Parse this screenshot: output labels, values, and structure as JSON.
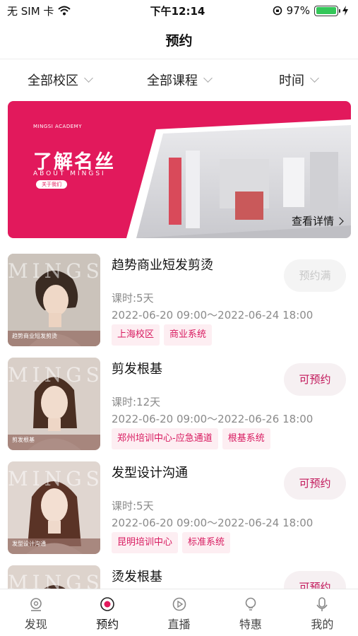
{
  "status_bar": {
    "carrier": "无 SIM 卡",
    "time": "下午12:14",
    "battery": "97%",
    "battery_level": 0.97
  },
  "nav": {
    "title": "预约"
  },
  "filters": [
    {
      "label": "全部校区"
    },
    {
      "label": "全部课程"
    },
    {
      "label": "时间"
    }
  ],
  "banner": {
    "academy": "MINGSI ACADEMY",
    "title": "了解名丝",
    "subtitle": "ABOUT MINGSI",
    "button": "关于我们",
    "detail_link": "查看详情"
  },
  "courses": [
    {
      "title": "趋势商业短发剪烫",
      "hours": "课时:5天",
      "time": "2022-06-20 09:00～2022-06-24 18:00",
      "tags": [
        "上海校区",
        "商业系统"
      ],
      "button": "预约满",
      "status": "full",
      "thumb_text": "MINGSI",
      "thumb_caption": "趋势商业短发剪烫"
    },
    {
      "title": "剪发根基",
      "hours": "课时:12天",
      "time": "2022-06-20 09:00～2022-06-26 18:00",
      "tags": [
        "郑州培训中心-应急通道",
        "根基系统"
      ],
      "button": "可预约",
      "status": "open",
      "thumb_text": "MINGSI",
      "thumb_caption": "剪发根基"
    },
    {
      "title": "发型设计沟通",
      "hours": "课时:5天",
      "time": "2022-06-20 09:00～2022-06-24 18:00",
      "tags": [
        "昆明培训中心",
        "标准系统"
      ],
      "button": "可预约",
      "status": "open",
      "thumb_text": "MINGSI",
      "thumb_caption": "发型设计沟通"
    },
    {
      "title": "烫发根基",
      "button": "可预约",
      "status": "open",
      "thumb_text": "MINGSI"
    }
  ],
  "tabs": [
    {
      "label": "发现",
      "icon": "discover-icon"
    },
    {
      "label": "预约",
      "icon": "booking-icon",
      "active": true
    },
    {
      "label": "直播",
      "icon": "live-icon"
    },
    {
      "label": "特惠",
      "icon": "deals-icon"
    },
    {
      "label": "我的",
      "icon": "profile-icon"
    }
  ],
  "colors": {
    "accent": "#e2195c",
    "tag_bg": "#fdeef2",
    "tag_text": "#d81b60"
  }
}
